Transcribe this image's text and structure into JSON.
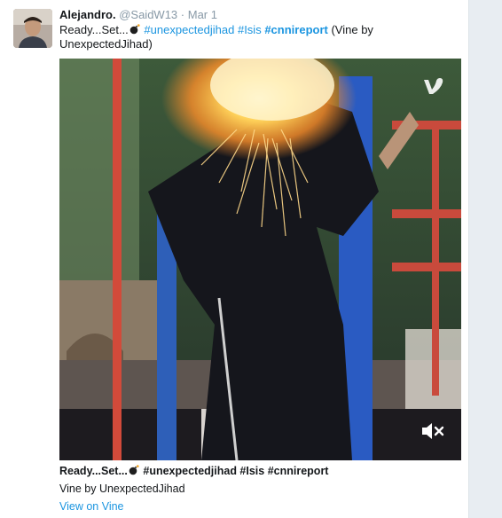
{
  "tweet": {
    "author_name": "Alejandro.",
    "handle": "@SaidW13",
    "separator": "·",
    "date": "Mar 1",
    "text_prefix": "Ready...Set...",
    "hashtags": [
      "#unexpectedjihad",
      "#Isis",
      "#cnnireport"
    ],
    "text_suffix": "(Vine by UnexpectedJihad)"
  },
  "media": {
    "provider_logo_icon": "vine-logo-icon",
    "mute_icon": "speaker-muted-icon"
  },
  "card": {
    "title_prefix": "Ready...Set...",
    "title_hashtags": "#unexpectedjihad #Isis #cnnireport",
    "description": "Vine by UnexpectedJihad",
    "link_label": "View on Vine"
  },
  "colors": {
    "hashtag_blue": "#1b95e0",
    "muted_gray": "#8899a6"
  }
}
